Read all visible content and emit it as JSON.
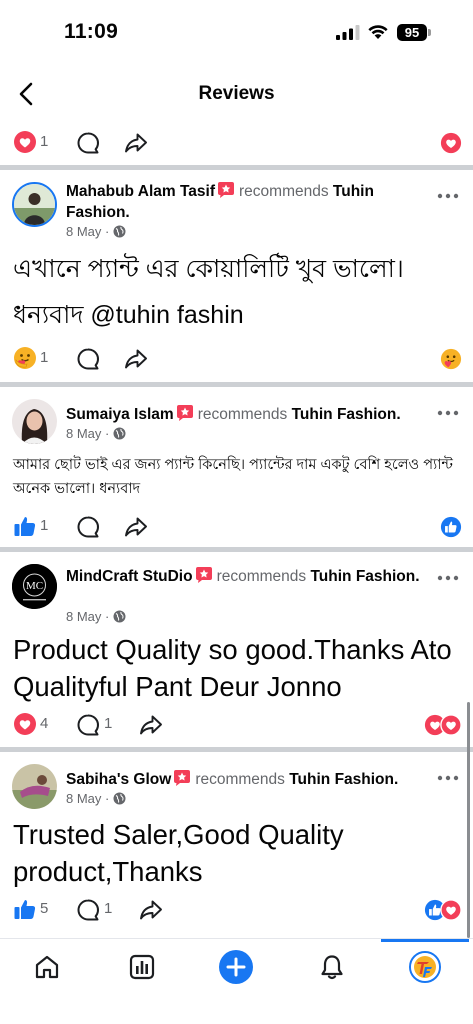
{
  "status_bar": {
    "time": "11:09",
    "battery": "95"
  },
  "header": {
    "title": "Reviews"
  },
  "top_row": {
    "reaction_count": "1"
  },
  "posts": [
    {
      "author": "Mahabub Alam Tasif",
      "recommends": "recommends",
      "page": "Tuhin Fashion.",
      "date": "8 May ·",
      "text": "এখানে প্যান্ট এর কোয়ালিটি খুব ভালো। ধন্যবাদ @tuhin fashin",
      "reaction_count": "1",
      "comment_count": ""
    },
    {
      "author": "Sumaiya Islam",
      "recommends": "recommends",
      "page": "Tuhin Fashion.",
      "date": "8 May ·",
      "text": "আমার ছোট ভাই এর জন্য প্যান্ট কিনেছি। প্যান্টের দাম একটু বেশি হলেও প্যান্ট অনেক ভালো। ধন্যবাদ",
      "reaction_count": "1",
      "comment_count": ""
    },
    {
      "author": "MindCraft StuDio",
      "recommends": "recommends",
      "page": "Tuhin Fashion.",
      "date": "8 May ·",
      "avatar_text": "MC",
      "text": "Product Quality so good.Thanks Ato Qualityful Pant Deur Jonno",
      "reaction_count": "4",
      "comment_count": "1"
    },
    {
      "author": "Sabiha's Glow",
      "recommends": "recommends",
      "page": "Tuhin Fashion.",
      "date": "8 May ·",
      "text": "Trusted Saler,Good Quality product,Thanks",
      "reaction_count": "5",
      "comment_count": "1"
    }
  ],
  "icons": {
    "love": "love-reaction-icon",
    "like": "like-reaction-icon",
    "care": "care-reaction-icon",
    "comment": "comment-icon",
    "share": "share-icon",
    "home": "home-icon",
    "insights": "insights-icon",
    "create": "plus-icon",
    "notifications": "bell-icon"
  },
  "colors": {
    "accent": "#1877f2",
    "love": "#f33e58",
    "care": "#f7b125",
    "divider": "#cdd0d4"
  }
}
